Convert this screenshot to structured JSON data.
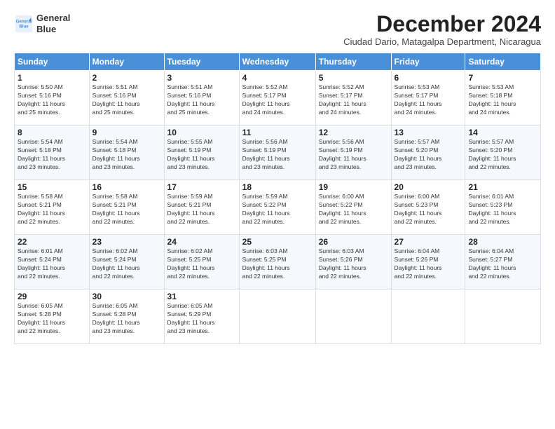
{
  "logo": {
    "line1": "General",
    "line2": "Blue"
  },
  "title": "December 2024",
  "subtitle": "Ciudad Dario, Matagalpa Department, Nicaragua",
  "headers": [
    "Sunday",
    "Monday",
    "Tuesday",
    "Wednesday",
    "Thursday",
    "Friday",
    "Saturday"
  ],
  "weeks": [
    [
      {
        "day": "1",
        "info": "Sunrise: 5:50 AM\nSunset: 5:16 PM\nDaylight: 11 hours\nand 25 minutes."
      },
      {
        "day": "2",
        "info": "Sunrise: 5:51 AM\nSunset: 5:16 PM\nDaylight: 11 hours\nand 25 minutes."
      },
      {
        "day": "3",
        "info": "Sunrise: 5:51 AM\nSunset: 5:16 PM\nDaylight: 11 hours\nand 25 minutes."
      },
      {
        "day": "4",
        "info": "Sunrise: 5:52 AM\nSunset: 5:17 PM\nDaylight: 11 hours\nand 24 minutes."
      },
      {
        "day": "5",
        "info": "Sunrise: 5:52 AM\nSunset: 5:17 PM\nDaylight: 11 hours\nand 24 minutes."
      },
      {
        "day": "6",
        "info": "Sunrise: 5:53 AM\nSunset: 5:17 PM\nDaylight: 11 hours\nand 24 minutes."
      },
      {
        "day": "7",
        "info": "Sunrise: 5:53 AM\nSunset: 5:18 PM\nDaylight: 11 hours\nand 24 minutes."
      }
    ],
    [
      {
        "day": "8",
        "info": "Sunrise: 5:54 AM\nSunset: 5:18 PM\nDaylight: 11 hours\nand 23 minutes."
      },
      {
        "day": "9",
        "info": "Sunrise: 5:54 AM\nSunset: 5:18 PM\nDaylight: 11 hours\nand 23 minutes."
      },
      {
        "day": "10",
        "info": "Sunrise: 5:55 AM\nSunset: 5:19 PM\nDaylight: 11 hours\nand 23 minutes."
      },
      {
        "day": "11",
        "info": "Sunrise: 5:56 AM\nSunset: 5:19 PM\nDaylight: 11 hours\nand 23 minutes."
      },
      {
        "day": "12",
        "info": "Sunrise: 5:56 AM\nSunset: 5:19 PM\nDaylight: 11 hours\nand 23 minutes."
      },
      {
        "day": "13",
        "info": "Sunrise: 5:57 AM\nSunset: 5:20 PM\nDaylight: 11 hours\nand 23 minutes."
      },
      {
        "day": "14",
        "info": "Sunrise: 5:57 AM\nSunset: 5:20 PM\nDaylight: 11 hours\nand 22 minutes."
      }
    ],
    [
      {
        "day": "15",
        "info": "Sunrise: 5:58 AM\nSunset: 5:21 PM\nDaylight: 11 hours\nand 22 minutes."
      },
      {
        "day": "16",
        "info": "Sunrise: 5:58 AM\nSunset: 5:21 PM\nDaylight: 11 hours\nand 22 minutes."
      },
      {
        "day": "17",
        "info": "Sunrise: 5:59 AM\nSunset: 5:21 PM\nDaylight: 11 hours\nand 22 minutes."
      },
      {
        "day": "18",
        "info": "Sunrise: 5:59 AM\nSunset: 5:22 PM\nDaylight: 11 hours\nand 22 minutes."
      },
      {
        "day": "19",
        "info": "Sunrise: 6:00 AM\nSunset: 5:22 PM\nDaylight: 11 hours\nand 22 minutes."
      },
      {
        "day": "20",
        "info": "Sunrise: 6:00 AM\nSunset: 5:23 PM\nDaylight: 11 hours\nand 22 minutes."
      },
      {
        "day": "21",
        "info": "Sunrise: 6:01 AM\nSunset: 5:23 PM\nDaylight: 11 hours\nand 22 minutes."
      }
    ],
    [
      {
        "day": "22",
        "info": "Sunrise: 6:01 AM\nSunset: 5:24 PM\nDaylight: 11 hours\nand 22 minutes."
      },
      {
        "day": "23",
        "info": "Sunrise: 6:02 AM\nSunset: 5:24 PM\nDaylight: 11 hours\nand 22 minutes."
      },
      {
        "day": "24",
        "info": "Sunrise: 6:02 AM\nSunset: 5:25 PM\nDaylight: 11 hours\nand 22 minutes."
      },
      {
        "day": "25",
        "info": "Sunrise: 6:03 AM\nSunset: 5:25 PM\nDaylight: 11 hours\nand 22 minutes."
      },
      {
        "day": "26",
        "info": "Sunrise: 6:03 AM\nSunset: 5:26 PM\nDaylight: 11 hours\nand 22 minutes."
      },
      {
        "day": "27",
        "info": "Sunrise: 6:04 AM\nSunset: 5:26 PM\nDaylight: 11 hours\nand 22 minutes."
      },
      {
        "day": "28",
        "info": "Sunrise: 6:04 AM\nSunset: 5:27 PM\nDaylight: 11 hours\nand 22 minutes."
      }
    ],
    [
      {
        "day": "29",
        "info": "Sunrise: 6:05 AM\nSunset: 5:28 PM\nDaylight: 11 hours\nand 22 minutes."
      },
      {
        "day": "30",
        "info": "Sunrise: 6:05 AM\nSunset: 5:28 PM\nDaylight: 11 hours\nand 23 minutes."
      },
      {
        "day": "31",
        "info": "Sunrise: 6:05 AM\nSunset: 5:29 PM\nDaylight: 11 hours\nand 23 minutes."
      },
      {
        "day": "",
        "info": ""
      },
      {
        "day": "",
        "info": ""
      },
      {
        "day": "",
        "info": ""
      },
      {
        "day": "",
        "info": ""
      }
    ]
  ]
}
